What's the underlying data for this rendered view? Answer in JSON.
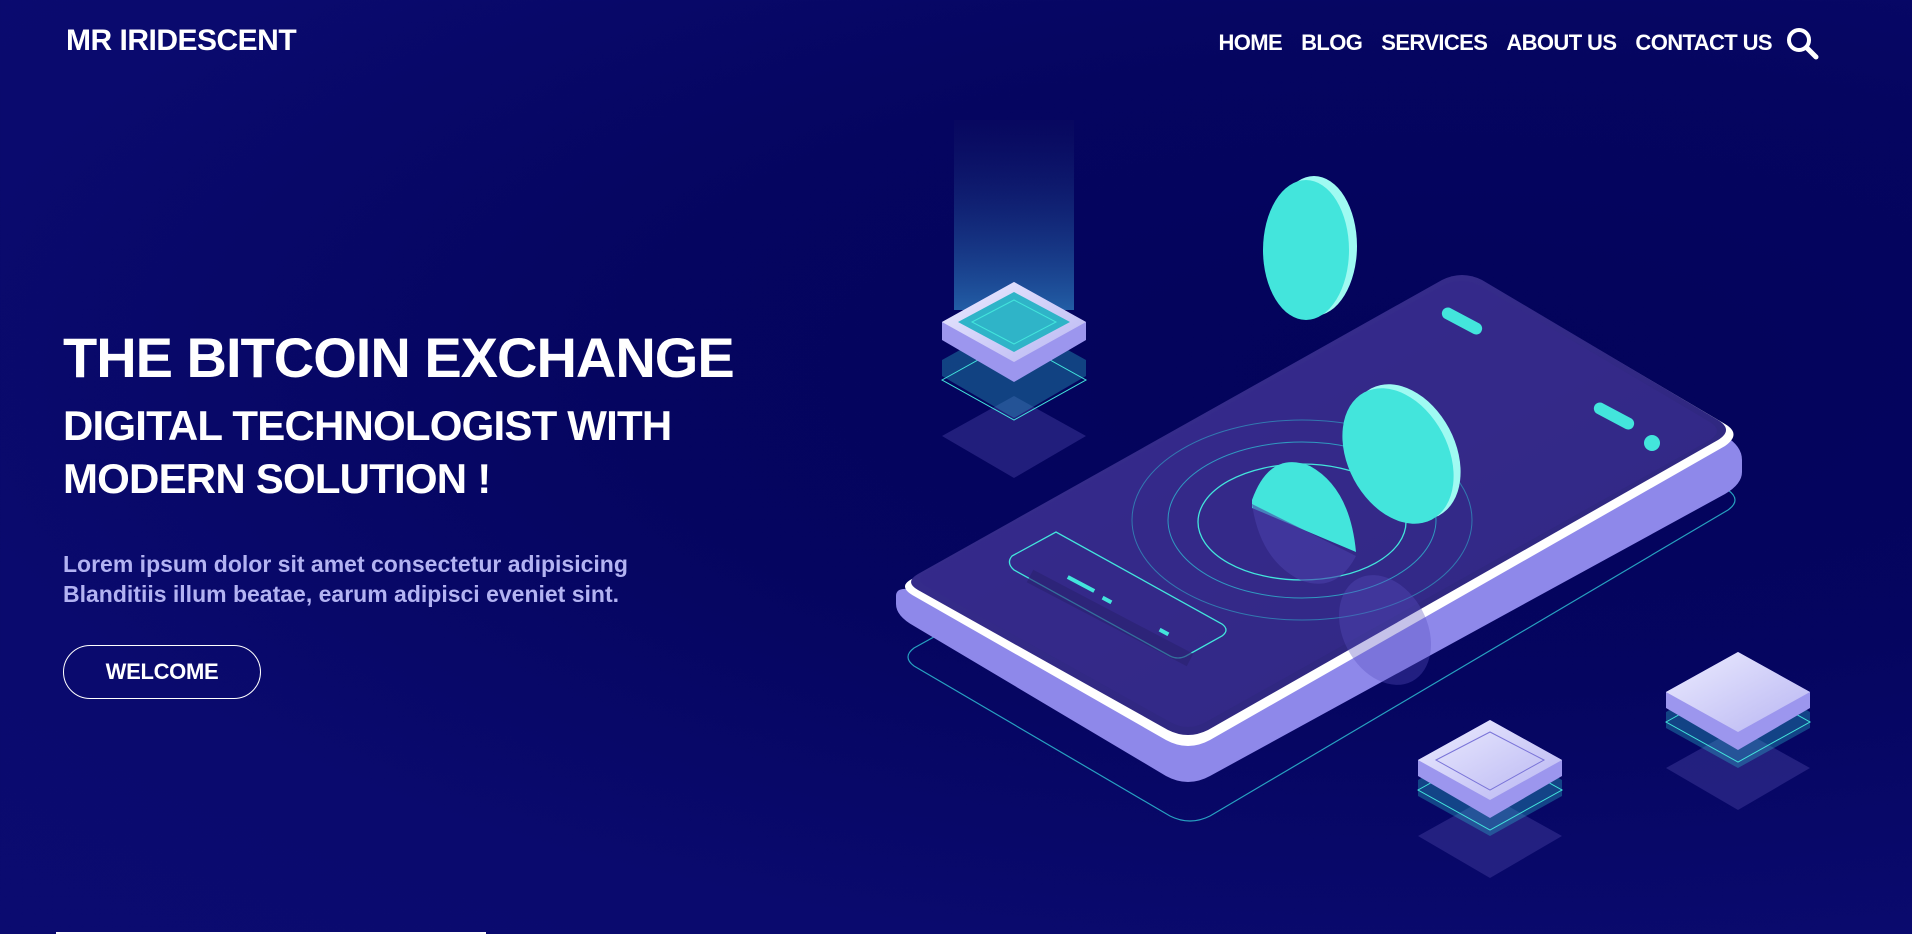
{
  "header": {
    "brand": "MR IRIDESCENT",
    "nav": [
      {
        "label": "HOME"
      },
      {
        "label": "BLOG"
      },
      {
        "label": "SERVICES"
      },
      {
        "label": "ABOUT US"
      },
      {
        "label": "CONTACT US"
      }
    ],
    "search_icon": "search-icon"
  },
  "hero": {
    "title": "THE BITCOIN EXCHANGE",
    "subtitle_line1": "DIGITAL TECHNOLOGIST WITH",
    "subtitle_line2": "MODERN SOLUTION !",
    "description_line1": "Lorem ipsum dolor sit amet consectetur adipisicing",
    "description_line2": "Blanditiis illum beatae, earum adipisci eveniet sint.",
    "button_label": "WELCOME"
  },
  "colors": {
    "background": "#07075f",
    "accent_cyan": "#43e5dc",
    "phone_purple": "#2e2a80",
    "phone_edge": "#8a84e6",
    "text_muted": "#b3b3f2"
  }
}
